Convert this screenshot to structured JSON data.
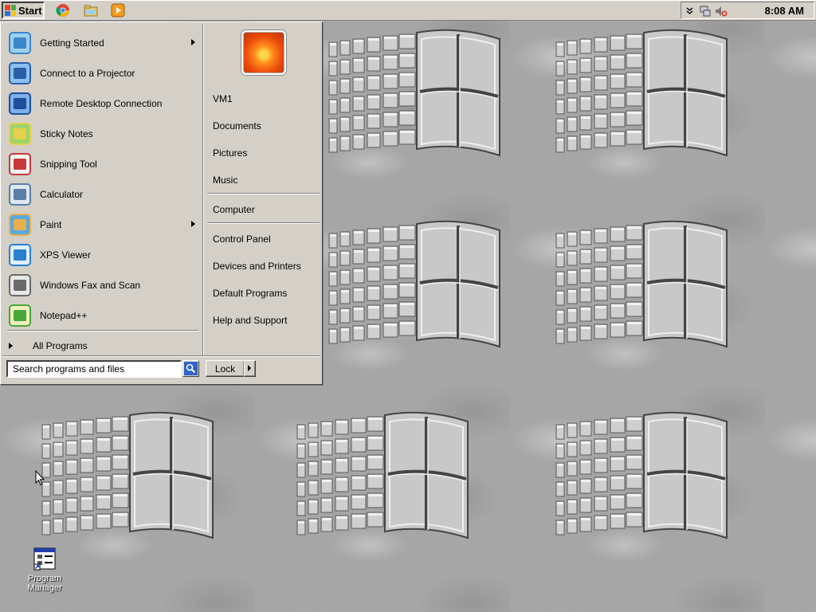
{
  "taskbar": {
    "start_label": "Start",
    "quick_launch": [
      {
        "name": "chrome-icon"
      },
      {
        "name": "explorer-folder-icon"
      },
      {
        "name": "media-player-icon"
      }
    ],
    "tray": {
      "clock": "8:08 AM",
      "icons": [
        "chevron-down-icon",
        "network-icon",
        "volume-muted-icon"
      ]
    }
  },
  "start_menu": {
    "programs": [
      {
        "label": "Getting Started",
        "icon": "getting-started-icon",
        "has_submenu": true
      },
      {
        "label": "Connect to a Projector",
        "icon": "projector-icon",
        "has_submenu": false
      },
      {
        "label": "Remote Desktop Connection",
        "icon": "remote-desktop-icon",
        "has_submenu": false
      },
      {
        "label": "Sticky Notes",
        "icon": "sticky-notes-icon",
        "has_submenu": false
      },
      {
        "label": "Snipping Tool",
        "icon": "snipping-tool-icon",
        "has_submenu": false
      },
      {
        "label": "Calculator",
        "icon": "calculator-icon",
        "has_submenu": false
      },
      {
        "label": "Paint",
        "icon": "paint-icon",
        "has_submenu": true
      },
      {
        "label": "XPS Viewer",
        "icon": "xps-viewer-icon",
        "has_submenu": false
      },
      {
        "label": "Windows Fax and Scan",
        "icon": "fax-scan-icon",
        "has_submenu": false
      },
      {
        "label": "Notepad++",
        "icon": "notepad-plus-plus-icon",
        "has_submenu": false
      }
    ],
    "all_programs": "All Programs",
    "user_links": [
      {
        "label": "VM1"
      },
      {
        "label": "Documents"
      },
      {
        "label": "Pictures"
      },
      {
        "label": "Music"
      }
    ],
    "system_links_a": [
      {
        "label": "Computer"
      }
    ],
    "system_links_b": [
      {
        "label": "Control Panel"
      },
      {
        "label": "Devices and Printers"
      },
      {
        "label": "Default Programs"
      },
      {
        "label": "Help and Support"
      }
    ],
    "search": {
      "placeholder": "Search programs and files"
    },
    "lock_label": "Lock"
  },
  "desktop": {
    "icons": [
      {
        "label": "Program Manager",
        "icon": "program-manager-icon"
      }
    ]
  }
}
